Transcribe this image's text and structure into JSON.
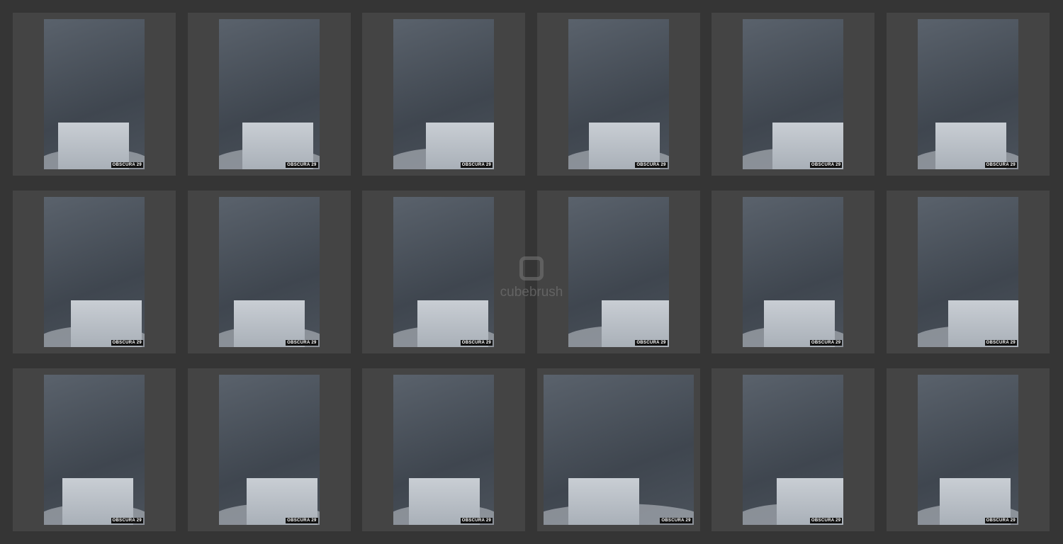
{
  "watermark": "cubebrush",
  "photo_label": "OBSCURA 29",
  "thumbnails": [
    {
      "row": 1,
      "col": 1,
      "wide": false
    },
    {
      "row": 1,
      "col": 2,
      "wide": false
    },
    {
      "row": 1,
      "col": 3,
      "wide": false
    },
    {
      "row": 1,
      "col": 4,
      "wide": false
    },
    {
      "row": 1,
      "col": 5,
      "wide": false
    },
    {
      "row": 1,
      "col": 6,
      "wide": false
    },
    {
      "row": 2,
      "col": 1,
      "wide": false
    },
    {
      "row": 2,
      "col": 2,
      "wide": false
    },
    {
      "row": 2,
      "col": 3,
      "wide": false
    },
    {
      "row": 2,
      "col": 4,
      "wide": false
    },
    {
      "row": 2,
      "col": 5,
      "wide": false
    },
    {
      "row": 2,
      "col": 6,
      "wide": false
    },
    {
      "row": 3,
      "col": 1,
      "wide": false
    },
    {
      "row": 3,
      "col": 2,
      "wide": false
    },
    {
      "row": 3,
      "col": 3,
      "wide": false
    },
    {
      "row": 3,
      "col": 4,
      "wide": true
    },
    {
      "row": 3,
      "col": 5,
      "wide": false
    },
    {
      "row": 3,
      "col": 6,
      "wide": false
    }
  ]
}
